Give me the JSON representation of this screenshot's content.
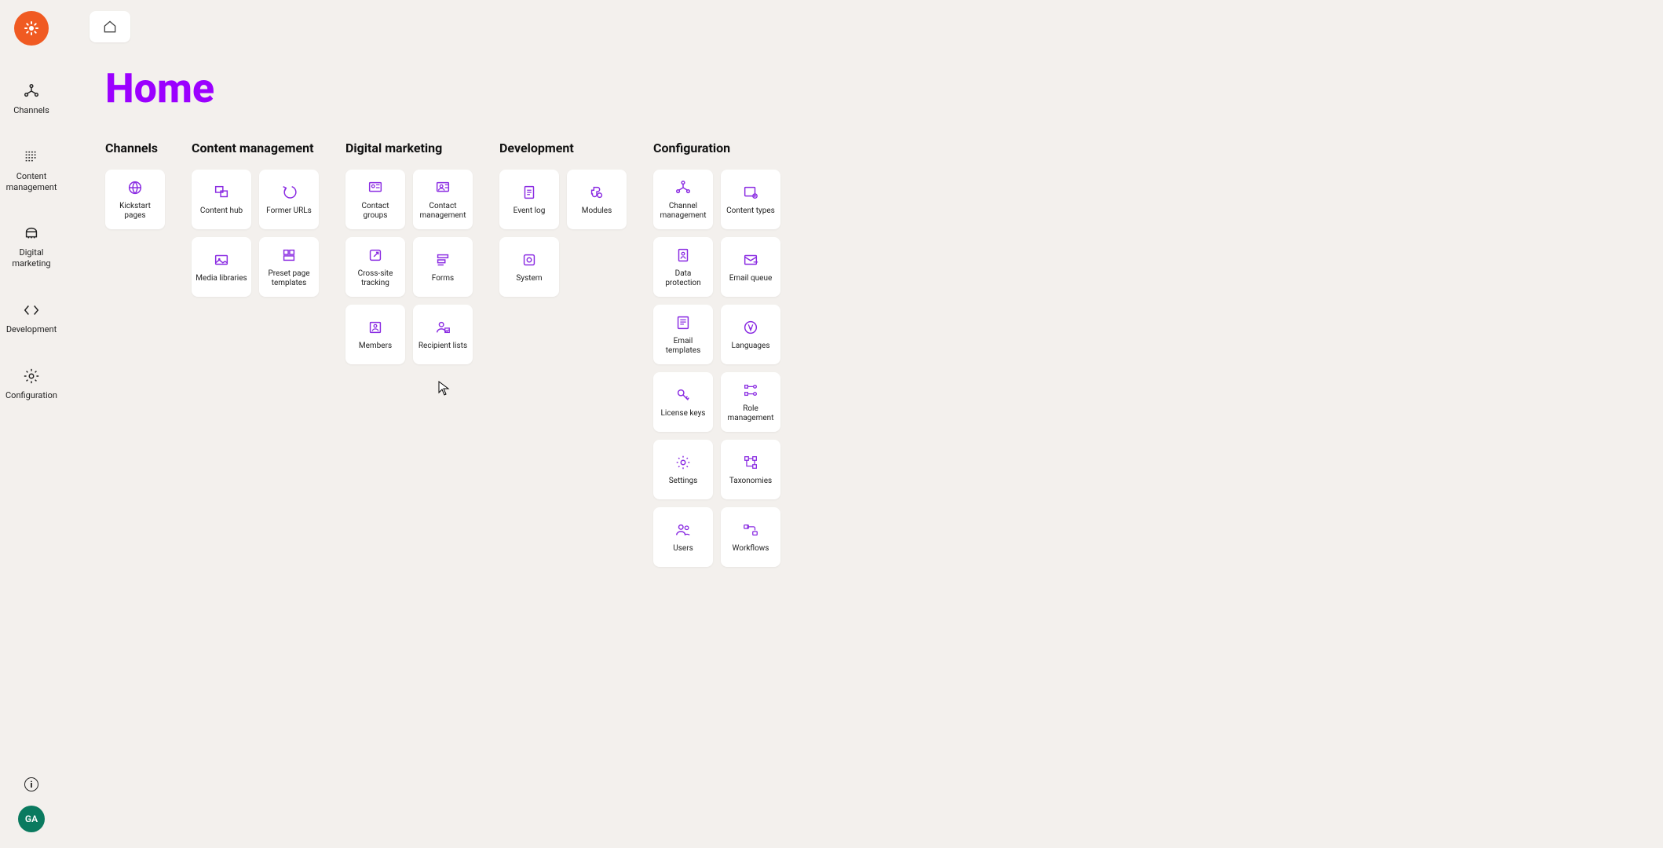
{
  "page_title": "Home",
  "avatar_initials": "GA",
  "sidebar": [
    {
      "id": "channels",
      "label": "Channels",
      "icon": "channels-icon"
    },
    {
      "id": "content-management",
      "label": "Content management",
      "icon": "content-mgmt-icon"
    },
    {
      "id": "digital-marketing",
      "label": "Digital marketing",
      "icon": "digital-mkt-icon"
    },
    {
      "id": "development",
      "label": "Development",
      "icon": "development-icon"
    },
    {
      "id": "configuration",
      "label": "Configuration",
      "icon": "configuration-icon"
    }
  ],
  "sections": {
    "channels": {
      "title": "Channels",
      "tiles": [
        {
          "id": "kickstart-pages",
          "label": "Kickstart pages",
          "icon": "globe-icon"
        }
      ]
    },
    "content_management": {
      "title": "Content management",
      "tiles": [
        {
          "id": "content-hub",
          "label": "Content hub",
          "icon": "content-hub-icon"
        },
        {
          "id": "former-urls",
          "label": "Former URLs",
          "icon": "former-urls-icon"
        },
        {
          "id": "media-libraries",
          "label": "Media libraries",
          "icon": "media-libraries-icon"
        },
        {
          "id": "preset-page-templates",
          "label": "Preset page templates",
          "icon": "preset-templates-icon"
        }
      ]
    },
    "digital_marketing": {
      "title": "Digital marketing",
      "tiles": [
        {
          "id": "contact-groups",
          "label": "Contact groups",
          "icon": "contact-groups-icon"
        },
        {
          "id": "contact-management",
          "label": "Contact management",
          "icon": "contact-mgmt-icon"
        },
        {
          "id": "cross-site-tracking",
          "label": "Cross-site tracking",
          "icon": "cross-site-icon"
        },
        {
          "id": "forms",
          "label": "Forms",
          "icon": "forms-icon"
        },
        {
          "id": "members",
          "label": "Members",
          "icon": "members-icon"
        },
        {
          "id": "recipient-lists",
          "label": "Recipient lists",
          "icon": "recipient-lists-icon"
        }
      ]
    },
    "development": {
      "title": "Development",
      "tiles": [
        {
          "id": "event-log",
          "label": "Event log",
          "icon": "event-log-icon"
        },
        {
          "id": "modules",
          "label": "Modules",
          "icon": "modules-icon"
        },
        {
          "id": "system",
          "label": "System",
          "icon": "system-icon"
        }
      ]
    },
    "configuration": {
      "title": "Configuration",
      "tiles": [
        {
          "id": "channel-management",
          "label": "Channel management",
          "icon": "channel-mgmt-icon"
        },
        {
          "id": "content-types",
          "label": "Content types",
          "icon": "content-types-icon"
        },
        {
          "id": "data-protection",
          "label": "Data protection",
          "icon": "data-protection-icon"
        },
        {
          "id": "email-queue",
          "label": "Email queue",
          "icon": "email-queue-icon"
        },
        {
          "id": "email-templates",
          "label": "Email templates",
          "icon": "email-templates-icon"
        },
        {
          "id": "languages",
          "label": "Languages",
          "icon": "languages-icon"
        },
        {
          "id": "license-keys",
          "label": "License keys",
          "icon": "license-keys-icon"
        },
        {
          "id": "role-management",
          "label": "Role management",
          "icon": "role-mgmt-icon"
        },
        {
          "id": "settings",
          "label": "Settings",
          "icon": "settings-icon"
        },
        {
          "id": "taxonomies",
          "label": "Taxonomies",
          "icon": "taxonomies-icon"
        },
        {
          "id": "users",
          "label": "Users",
          "icon": "users-icon"
        },
        {
          "id": "workflows",
          "label": "Workflows",
          "icon": "workflows-icon"
        }
      ]
    }
  }
}
